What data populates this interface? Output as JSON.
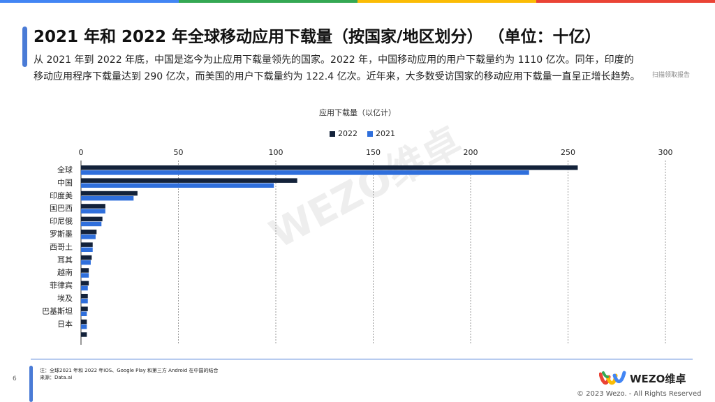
{
  "header": {
    "title": "2021 年和 2022 年全球移动应用下载量（按国家/地区划分）  （单位：十亿）",
    "description": "从 2021 年到 2022 年底，中国是迄今为止应用下载量领先的国家。2022 年，中国移动应用的用户下载量约为 1110 亿次。同年，印度的移动应用程序下载量达到 290 亿次，而美国的用户下载量约为 122.4 亿次。近年来，大多数受访国家的移动应用下载量一直呈正增长趋势。",
    "qr_text": "扫描领取报告"
  },
  "chart_data": {
    "type": "bar",
    "orientation": "horizontal",
    "title": "应用下载量（以亿计）",
    "categories": [
      "全球",
      "中国",
      "印度美",
      "国巴西",
      "印尼俄",
      "罗斯墨",
      "西哥土",
      "耳其",
      "越南",
      "菲律宾",
      "埃及",
      "巴基斯坦",
      "日本",
      ""
    ],
    "series": [
      {
        "name": "2022",
        "color": "#13223a",
        "values": [
          255,
          111,
          29,
          12.5,
          11,
          8,
          6,
          5.5,
          4,
          4,
          3.5,
          3.5,
          3,
          3
        ]
      },
      {
        "name": "2021",
        "color": "#2f6fdc",
        "values": [
          230,
          99,
          27,
          12.5,
          10.5,
          7.5,
          6,
          5,
          4,
          3.5,
          3.5,
          3,
          3,
          0
        ]
      }
    ],
    "xlim": [
      0,
      300
    ],
    "xticks": [
      0,
      50,
      100,
      150,
      200,
      250,
      300
    ],
    "grid": true,
    "legend": "top-center"
  },
  "footer": {
    "page_number": "6",
    "note_line1": "注：全球2021 年和 2022 年iOS、Google Play 和第三方 Android 在中国的结合",
    "note_line2": "来源：Data.ai",
    "logo_text": "WEZO维卓",
    "copyright": "© 2023 Wezo. - All Rights Reserved",
    "watermark": "WEZO维卓"
  },
  "colors": {
    "accent": "#4a7bd6",
    "topbar": [
      "#4285f4",
      "#34a853",
      "#fbbc05",
      "#ea4335"
    ]
  }
}
